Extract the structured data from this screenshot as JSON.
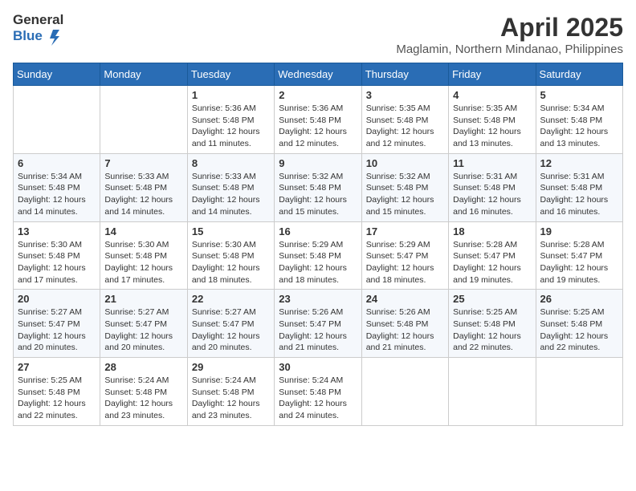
{
  "header": {
    "logo_general": "General",
    "logo_blue": "Blue",
    "title": "April 2025",
    "location": "Maglamin, Northern Mindanao, Philippines"
  },
  "columns": [
    "Sunday",
    "Monday",
    "Tuesday",
    "Wednesday",
    "Thursday",
    "Friday",
    "Saturday"
  ],
  "weeks": [
    [
      {
        "day": "",
        "sunrise": "",
        "sunset": "",
        "daylight": ""
      },
      {
        "day": "",
        "sunrise": "",
        "sunset": "",
        "daylight": ""
      },
      {
        "day": "1",
        "sunrise": "Sunrise: 5:36 AM",
        "sunset": "Sunset: 5:48 PM",
        "daylight": "Daylight: 12 hours and 11 minutes."
      },
      {
        "day": "2",
        "sunrise": "Sunrise: 5:36 AM",
        "sunset": "Sunset: 5:48 PM",
        "daylight": "Daylight: 12 hours and 12 minutes."
      },
      {
        "day": "3",
        "sunrise": "Sunrise: 5:35 AM",
        "sunset": "Sunset: 5:48 PM",
        "daylight": "Daylight: 12 hours and 12 minutes."
      },
      {
        "day": "4",
        "sunrise": "Sunrise: 5:35 AM",
        "sunset": "Sunset: 5:48 PM",
        "daylight": "Daylight: 12 hours and 13 minutes."
      },
      {
        "day": "5",
        "sunrise": "Sunrise: 5:34 AM",
        "sunset": "Sunset: 5:48 PM",
        "daylight": "Daylight: 12 hours and 13 minutes."
      }
    ],
    [
      {
        "day": "6",
        "sunrise": "Sunrise: 5:34 AM",
        "sunset": "Sunset: 5:48 PM",
        "daylight": "Daylight: 12 hours and 14 minutes."
      },
      {
        "day": "7",
        "sunrise": "Sunrise: 5:33 AM",
        "sunset": "Sunset: 5:48 PM",
        "daylight": "Daylight: 12 hours and 14 minutes."
      },
      {
        "day": "8",
        "sunrise": "Sunrise: 5:33 AM",
        "sunset": "Sunset: 5:48 PM",
        "daylight": "Daylight: 12 hours and 14 minutes."
      },
      {
        "day": "9",
        "sunrise": "Sunrise: 5:32 AM",
        "sunset": "Sunset: 5:48 PM",
        "daylight": "Daylight: 12 hours and 15 minutes."
      },
      {
        "day": "10",
        "sunrise": "Sunrise: 5:32 AM",
        "sunset": "Sunset: 5:48 PM",
        "daylight": "Daylight: 12 hours and 15 minutes."
      },
      {
        "day": "11",
        "sunrise": "Sunrise: 5:31 AM",
        "sunset": "Sunset: 5:48 PM",
        "daylight": "Daylight: 12 hours and 16 minutes."
      },
      {
        "day": "12",
        "sunrise": "Sunrise: 5:31 AM",
        "sunset": "Sunset: 5:48 PM",
        "daylight": "Daylight: 12 hours and 16 minutes."
      }
    ],
    [
      {
        "day": "13",
        "sunrise": "Sunrise: 5:30 AM",
        "sunset": "Sunset: 5:48 PM",
        "daylight": "Daylight: 12 hours and 17 minutes."
      },
      {
        "day": "14",
        "sunrise": "Sunrise: 5:30 AM",
        "sunset": "Sunset: 5:48 PM",
        "daylight": "Daylight: 12 hours and 17 minutes."
      },
      {
        "day": "15",
        "sunrise": "Sunrise: 5:30 AM",
        "sunset": "Sunset: 5:48 PM",
        "daylight": "Daylight: 12 hours and 18 minutes."
      },
      {
        "day": "16",
        "sunrise": "Sunrise: 5:29 AM",
        "sunset": "Sunset: 5:48 PM",
        "daylight": "Daylight: 12 hours and 18 minutes."
      },
      {
        "day": "17",
        "sunrise": "Sunrise: 5:29 AM",
        "sunset": "Sunset: 5:47 PM",
        "daylight": "Daylight: 12 hours and 18 minutes."
      },
      {
        "day": "18",
        "sunrise": "Sunrise: 5:28 AM",
        "sunset": "Sunset: 5:47 PM",
        "daylight": "Daylight: 12 hours and 19 minutes."
      },
      {
        "day": "19",
        "sunrise": "Sunrise: 5:28 AM",
        "sunset": "Sunset: 5:47 PM",
        "daylight": "Daylight: 12 hours and 19 minutes."
      }
    ],
    [
      {
        "day": "20",
        "sunrise": "Sunrise: 5:27 AM",
        "sunset": "Sunset: 5:47 PM",
        "daylight": "Daylight: 12 hours and 20 minutes."
      },
      {
        "day": "21",
        "sunrise": "Sunrise: 5:27 AM",
        "sunset": "Sunset: 5:47 PM",
        "daylight": "Daylight: 12 hours and 20 minutes."
      },
      {
        "day": "22",
        "sunrise": "Sunrise: 5:27 AM",
        "sunset": "Sunset: 5:47 PM",
        "daylight": "Daylight: 12 hours and 20 minutes."
      },
      {
        "day": "23",
        "sunrise": "Sunrise: 5:26 AM",
        "sunset": "Sunset: 5:47 PM",
        "daylight": "Daylight: 12 hours and 21 minutes."
      },
      {
        "day": "24",
        "sunrise": "Sunrise: 5:26 AM",
        "sunset": "Sunset: 5:48 PM",
        "daylight": "Daylight: 12 hours and 21 minutes."
      },
      {
        "day": "25",
        "sunrise": "Sunrise: 5:25 AM",
        "sunset": "Sunset: 5:48 PM",
        "daylight": "Daylight: 12 hours and 22 minutes."
      },
      {
        "day": "26",
        "sunrise": "Sunrise: 5:25 AM",
        "sunset": "Sunset: 5:48 PM",
        "daylight": "Daylight: 12 hours and 22 minutes."
      }
    ],
    [
      {
        "day": "27",
        "sunrise": "Sunrise: 5:25 AM",
        "sunset": "Sunset: 5:48 PM",
        "daylight": "Daylight: 12 hours and 22 minutes."
      },
      {
        "day": "28",
        "sunrise": "Sunrise: 5:24 AM",
        "sunset": "Sunset: 5:48 PM",
        "daylight": "Daylight: 12 hours and 23 minutes."
      },
      {
        "day": "29",
        "sunrise": "Sunrise: 5:24 AM",
        "sunset": "Sunset: 5:48 PM",
        "daylight": "Daylight: 12 hours and 23 minutes."
      },
      {
        "day": "30",
        "sunrise": "Sunrise: 5:24 AM",
        "sunset": "Sunset: 5:48 PM",
        "daylight": "Daylight: 12 hours and 24 minutes."
      },
      {
        "day": "",
        "sunrise": "",
        "sunset": "",
        "daylight": ""
      },
      {
        "day": "",
        "sunrise": "",
        "sunset": "",
        "daylight": ""
      },
      {
        "day": "",
        "sunrise": "",
        "sunset": "",
        "daylight": ""
      }
    ]
  ]
}
